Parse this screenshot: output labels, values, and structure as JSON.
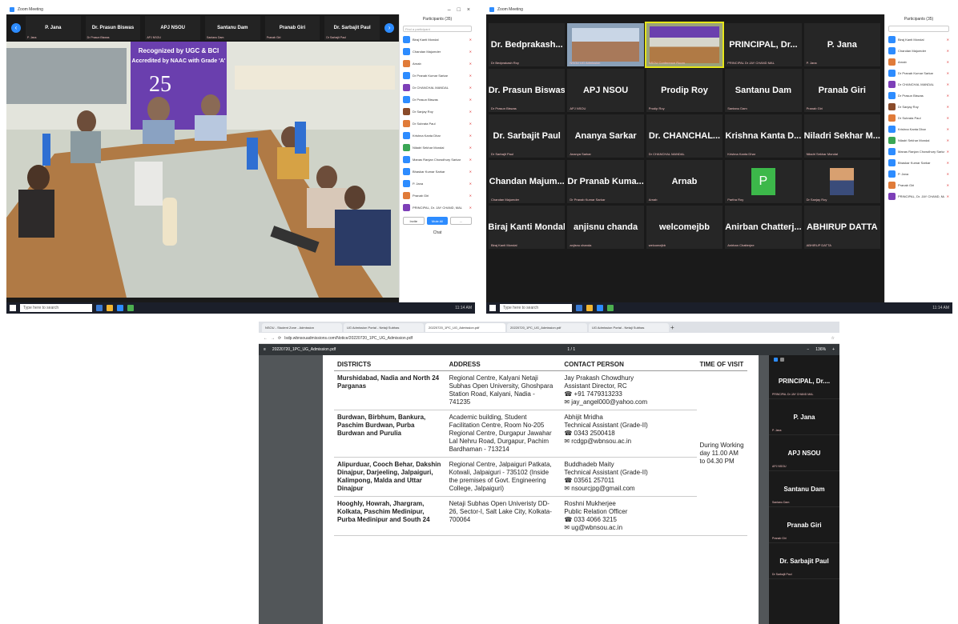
{
  "shot1": {
    "title": "Zoom Meeting",
    "gallery": [
      {
        "name": "P. Jana",
        "sub": "P. Jana"
      },
      {
        "name": "Dr. Prasun Biswas",
        "sub": "Dr Prasun Biswas"
      },
      {
        "name": "APJ NSOU",
        "sub": "APJ NSOU"
      },
      {
        "name": "Santanu Dam",
        "sub": "Santanu Dam"
      },
      {
        "name": "Pranab Giri",
        "sub": "Pranab Giri"
      },
      {
        "name": "Dr. Sarbajit Paul",
        "sub": "Dr Sarbajit Paul"
      }
    ],
    "banner_line1": "Recognized by UGC & BCI",
    "banner_line2": "Accredited by NAAC with Grade 'A'",
    "banner_num": "25",
    "panel": {
      "title": "Participants (35)",
      "search_placeholder": "Find a participant",
      "participants": [
        {
          "name": "Biraj Kanti Mondal",
          "color": "#2d8cff"
        },
        {
          "name": "Chandan Majumder",
          "color": "#2d8cff"
        },
        {
          "name": "Arnab",
          "color": "#e07b39"
        },
        {
          "name": "Dr Pranab Kumar Sarkar",
          "color": "#2d8cff"
        },
        {
          "name": "Dr CHANCHAL MANDAL",
          "color": "#7d3fb8"
        },
        {
          "name": "Dr Prasun Biswas",
          "color": "#2d8cff"
        },
        {
          "name": "Dr Sanjay Roy",
          "color": "#8a4b2a"
        },
        {
          "name": "Dr Subrata Paul",
          "color": "#e07b39"
        },
        {
          "name": "Krishna Kanta Dhar",
          "color": "#2d8cff"
        },
        {
          "name": "Niladri Sekhar Mondal",
          "color": "#3aa655"
        },
        {
          "name": "Manas Ranjan Chowdhury Sarkar",
          "color": "#2d8cff"
        },
        {
          "name": "Bhaskar Kumar Sarkar",
          "color": "#2d8cff"
        },
        {
          "name": "P. Jana",
          "color": "#2d8cff"
        },
        {
          "name": "Pranab Giri",
          "color": "#e07b39"
        },
        {
          "name": "PRINCIPAL, Dr. JAY CHAND, MAL",
          "color": "#7d3fb8"
        }
      ],
      "invite": "Invite",
      "mute_all": "Mute All",
      "more": "...",
      "chat_label": "Chat"
    },
    "taskbar_search": "Type here to search",
    "tray_time": "11:14 AM"
  },
  "shot2": {
    "title": "Zoom Meeting",
    "tiles": [
      {
        "name": "Dr. Bedprakash...",
        "sub": "Dr Bedprakash Roy",
        "type": "name"
      },
      {
        "name": "",
        "sub": "NSOU UG Admission",
        "type": "video1"
      },
      {
        "name": "",
        "sub": "NSOU Conference Room",
        "type": "video2"
      },
      {
        "name": "PRINCIPAL, Dr...",
        "sub": "PRINCIPAL Dr JAY CHAND MAL",
        "type": "name"
      },
      {
        "name": "P. Jana",
        "sub": "P. Jana",
        "type": "name"
      },
      {
        "name": "Dr. Prasun Biswas",
        "sub": "Dr Prasun Biswas",
        "type": "name"
      },
      {
        "name": "APJ NSOU",
        "sub": "APJ NSOU",
        "type": "name"
      },
      {
        "name": "Prodip Roy",
        "sub": "Prodip Roy",
        "type": "name"
      },
      {
        "name": "Santanu Dam",
        "sub": "Santanu Dam",
        "type": "name"
      },
      {
        "name": "Pranab Giri",
        "sub": "Pranab Giri",
        "type": "name"
      },
      {
        "name": "Dr. Sarbajit Paul",
        "sub": "Dr Sarbajit Paul",
        "type": "name"
      },
      {
        "name": "Ananya Sarkar",
        "sub": "Ananya Sarkar",
        "type": "name"
      },
      {
        "name": "Dr. CHANCHAL...",
        "sub": "Dr CHANCHAL MANDAL",
        "type": "name"
      },
      {
        "name": "Krishna Kanta D...",
        "sub": "Krishna Kanta Dhar",
        "type": "name"
      },
      {
        "name": "Niladri Sekhar M...",
        "sub": "Niladri Sekhar Mondal",
        "type": "name"
      },
      {
        "name": "Chandan Majum...",
        "sub": "Chandan Majumder",
        "type": "name"
      },
      {
        "name": "Dr Pranab Kuma...",
        "sub": "Dr Pranab Kumar Sarkar",
        "type": "name"
      },
      {
        "name": "Arnab",
        "sub": "Arnab",
        "type": "name"
      },
      {
        "name": "P",
        "sub": "Partha Roy",
        "type": "avatar"
      },
      {
        "name": "",
        "sub": "Dr Sanjay Roy",
        "type": "photo"
      },
      {
        "name": "Biraj Kanti Mondal",
        "sub": "Biraj Kanti Mondal",
        "type": "name"
      },
      {
        "name": "anjisnu chanda",
        "sub": "anjisnu chanda",
        "type": "name"
      },
      {
        "name": "welcomejbb",
        "sub": "welcomejbb",
        "type": "name"
      },
      {
        "name": "Anirban Chatterj...",
        "sub": "Anirban Chatterjee",
        "type": "name"
      },
      {
        "name": "ABHIRUP DATTA",
        "sub": "ABHIRUP DATTA",
        "type": "name"
      }
    ],
    "panel_title": "Participants (35)",
    "taskbar_search": "Type here to search",
    "tray_time": "11:14 AM"
  },
  "shot3": {
    "tabs": [
      "NSOU - Student Zone - Admission",
      "UG Admission Portal - Netaji Subhas",
      "20220720_1PC_UG_Admission.pdf",
      "20220720_1PC_UG_Admission.pdf",
      "UG Admission Portal - Netaji Subhas"
    ],
    "url": "lsdp.wbnsouadmissions.com/Notice/20220720_1PC_UG_Admission.pdf",
    "pdf_title": "20220720_1PC_UG_Admission.pdf",
    "page_indicator": "1 / 1",
    "zoom": "136%",
    "headers": [
      "DISTRICTS",
      "ADDRESS",
      "CONTACT PERSON",
      "TIME OF VISIT"
    ],
    "rows": [
      {
        "district": "Murshidabad, Nadia and North 24 Parganas",
        "address": "Regional Centre, Kalyani Netaji Subhas Open University, Ghoshpara Station Road, Kalyani, Nadia - 741235",
        "contact_name": "Jay Prakash Chowdhury",
        "contact_title": "Assistant Director, RC",
        "phone": "+91 7479313233",
        "email": "jay_angel000@yahoo.com"
      },
      {
        "district": "Burdwan, Birbhum, Bankura, Paschim Burdwan, Purba Burdwan and Purulia",
        "address": "Academic building, Student Facilitation Centre, Room No-205 Regional Centre, Durgapur Jawahar Lal Nehru Road, Durgapur, Pachim Bardhaman - 713214",
        "contact_name": "Abhijit Mridha",
        "contact_title": "Technical Assistant (Grade-II)",
        "phone": "0343 2500418",
        "email": "rcdgp@wbnsou.ac.in"
      },
      {
        "district": "Alipurduar, Cooch Behar, Dakshin Dinajpur, Darjeeling, Jalpaiguri, Kalimpong, Malda and Uttar Dinajpur",
        "address": "Regional Centre, Jalpaiguri Patkata, Kotwali, Jalpaiguri - 735102 (Inside the premises of Govt. Engineering College, Jalpaiguri)",
        "contact_name": "Buddhadeb Maity",
        "contact_title": "Technical Assistant (Grade-II)",
        "phone": "03561 257011",
        "email": "nsourcjpg@gmail.com"
      },
      {
        "district": "Hooghly, Howrah, Jhargram, Kolkata, Paschim Medinipur, Purba Medinipur and South 24",
        "address": "Netaji Subhas Open Univeristy DD-26, Sector-I, Salt Lake City, Kolkata-700064",
        "contact_name": "Roshni Mukherjee",
        "contact_title": "Public Relation Officer",
        "phone": "033 4066 3215",
        "email": "ug@wbnsou.ac.in"
      }
    ],
    "time_of_visit": "During Working day 11.00 AM to 04.30 PM",
    "zoom_side": [
      {
        "name": "PRINCIPAL, Dr....",
        "sub": "PRINCIPAL Dr JAY CHAND MAL"
      },
      {
        "name": "P. Jana",
        "sub": "P. Jana"
      },
      {
        "name": "APJ NSOU",
        "sub": "APJ NSOU"
      },
      {
        "name": "Santanu Dam",
        "sub": "Santanu Dam"
      },
      {
        "name": "Pranab Giri",
        "sub": "Pranab Giri"
      },
      {
        "name": "Dr. Sarbajit Paul",
        "sub": "Dr Sarbajit Paul"
      }
    ]
  }
}
